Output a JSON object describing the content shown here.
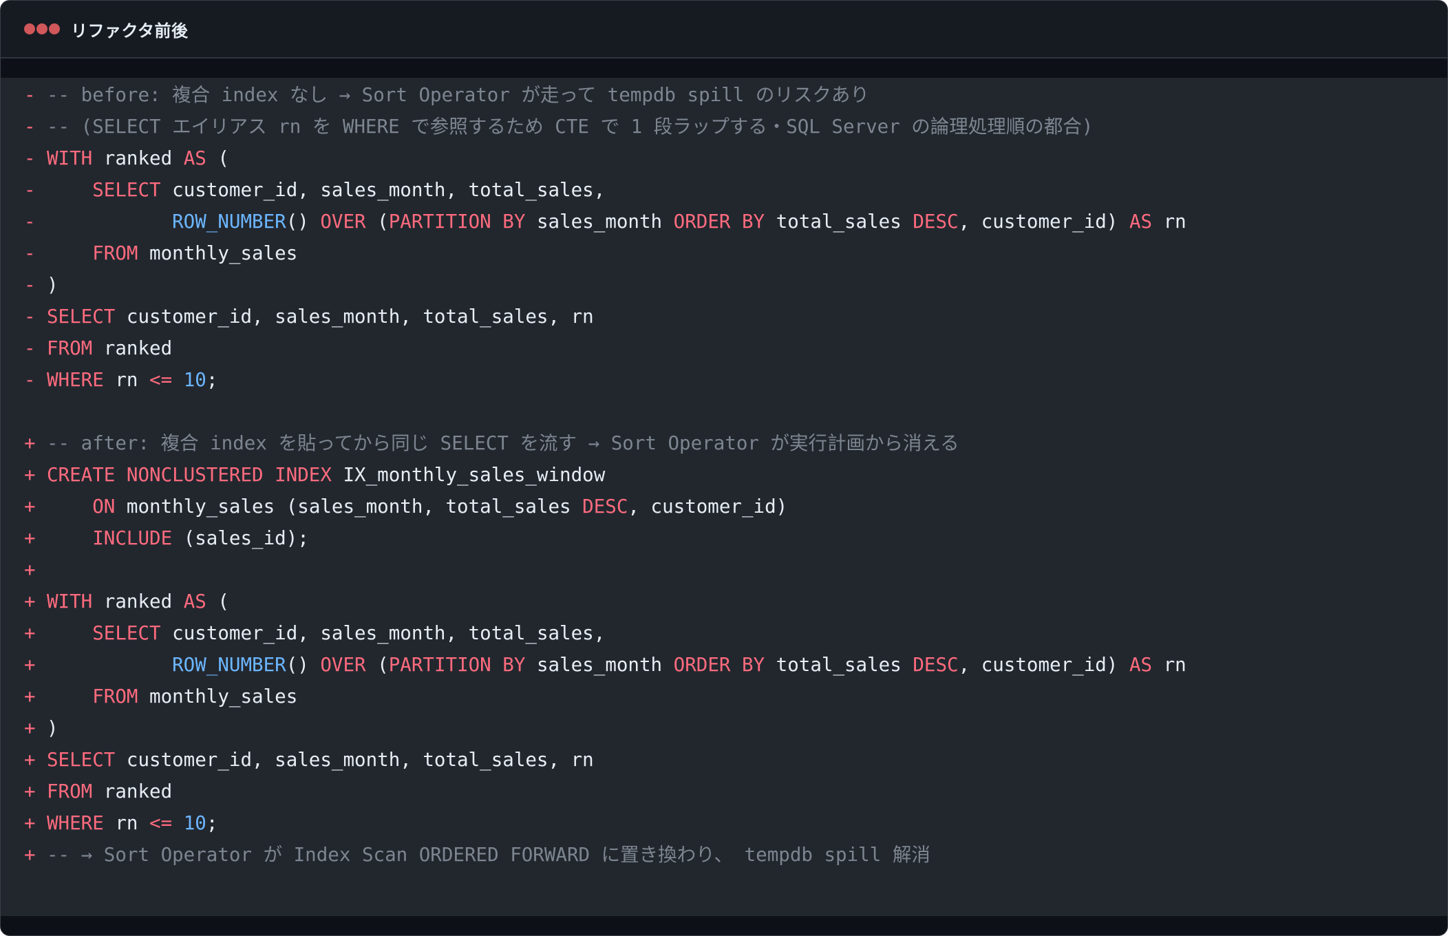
{
  "window": {
    "title": "リファクタ前後",
    "controls": [
      "close-dot",
      "minimize-dot",
      "maximize-dot"
    ]
  },
  "colors": {
    "background": "#22272e",
    "titlebar": "#161b22",
    "keyword": "#ff6b7e",
    "function": "#6cb6ff",
    "number": "#6cb6ff",
    "comment": "#7d8590",
    "text": "#e6edf3",
    "marker": "#ff6b7e"
  },
  "diff_lines": [
    {
      "marker": "-",
      "type": "del",
      "tokens": [
        {
          "t": "comment",
          "v": "-- before: 複合 index なし → Sort Operator が走って tempdb spill のリスクあり"
        }
      ]
    },
    {
      "marker": "-",
      "type": "del",
      "tokens": [
        {
          "t": "comment",
          "v": "-- (SELECT エイリアス rn を WHERE で参照するため CTE で 1 段ラップする・SQL Server の論理処理順の都合)"
        }
      ]
    },
    {
      "marker": "-",
      "type": "del",
      "tokens": [
        {
          "t": "kw",
          "v": "WITH"
        },
        {
          "t": "plain",
          "v": " ranked "
        },
        {
          "t": "kw",
          "v": "AS"
        },
        {
          "t": "plain",
          "v": " ("
        }
      ]
    },
    {
      "marker": "-",
      "type": "del",
      "tokens": [
        {
          "t": "plain",
          "v": "    "
        },
        {
          "t": "kw",
          "v": "SELECT"
        },
        {
          "t": "plain",
          "v": " customer_id, sales_month, total_sales,"
        }
      ]
    },
    {
      "marker": "-",
      "type": "del",
      "tokens": [
        {
          "t": "plain",
          "v": "           "
        },
        {
          "t": "fn",
          "v": "ROW_NUMBER"
        },
        {
          "t": "plain",
          "v": "() "
        },
        {
          "t": "kw",
          "v": "OVER"
        },
        {
          "t": "plain",
          "v": " ("
        },
        {
          "t": "kw",
          "v": "PARTITION BY"
        },
        {
          "t": "plain",
          "v": " sales_month "
        },
        {
          "t": "kw",
          "v": "ORDER BY"
        },
        {
          "t": "plain",
          "v": " total_sales "
        },
        {
          "t": "kw",
          "v": "DESC"
        },
        {
          "t": "plain",
          "v": ", customer_id) "
        },
        {
          "t": "kw",
          "v": "AS"
        },
        {
          "t": "plain",
          "v": " rn"
        }
      ]
    },
    {
      "marker": "-",
      "type": "del",
      "tokens": [
        {
          "t": "plain",
          "v": "    "
        },
        {
          "t": "kw",
          "v": "FROM"
        },
        {
          "t": "plain",
          "v": " monthly_sales"
        }
      ]
    },
    {
      "marker": "-",
      "type": "del",
      "tokens": [
        {
          "t": "plain",
          "v": ")"
        }
      ]
    },
    {
      "marker": "-",
      "type": "del",
      "tokens": [
        {
          "t": "kw",
          "v": "SELECT"
        },
        {
          "t": "plain",
          "v": " customer_id, sales_month, total_sales, rn"
        }
      ]
    },
    {
      "marker": "-",
      "type": "del",
      "tokens": [
        {
          "t": "kw",
          "v": "FROM"
        },
        {
          "t": "plain",
          "v": " ranked"
        }
      ]
    },
    {
      "marker": "-",
      "type": "del",
      "tokens": [
        {
          "t": "kw",
          "v": "WHERE"
        },
        {
          "t": "plain",
          "v": " rn "
        },
        {
          "t": "kw",
          "v": "<="
        },
        {
          "t": "plain",
          "v": " "
        },
        {
          "t": "num",
          "v": "10"
        },
        {
          "t": "plain",
          "v": ";"
        }
      ]
    },
    {
      "marker": "",
      "type": "blank",
      "tokens": []
    },
    {
      "marker": "+",
      "type": "add",
      "tokens": [
        {
          "t": "comment",
          "v": "-- after: 複合 index を貼ってから同じ SELECT を流す → Sort Operator が実行計画から消える"
        }
      ]
    },
    {
      "marker": "+",
      "type": "add",
      "tokens": [
        {
          "t": "kw",
          "v": "CREATE NONCLUSTERED INDEX"
        },
        {
          "t": "plain",
          "v": " IX_monthly_sales_window"
        }
      ]
    },
    {
      "marker": "+",
      "type": "add",
      "tokens": [
        {
          "t": "plain",
          "v": "    "
        },
        {
          "t": "kw",
          "v": "ON"
        },
        {
          "t": "plain",
          "v": " monthly_sales (sales_month, total_sales "
        },
        {
          "t": "kw",
          "v": "DESC"
        },
        {
          "t": "plain",
          "v": ", customer_id)"
        }
      ]
    },
    {
      "marker": "+",
      "type": "add",
      "tokens": [
        {
          "t": "plain",
          "v": "    "
        },
        {
          "t": "kw",
          "v": "INCLUDE"
        },
        {
          "t": "plain",
          "v": " (sales_id);"
        }
      ]
    },
    {
      "marker": "+",
      "type": "add",
      "tokens": []
    },
    {
      "marker": "+",
      "type": "add",
      "tokens": [
        {
          "t": "kw",
          "v": "WITH"
        },
        {
          "t": "plain",
          "v": " ranked "
        },
        {
          "t": "kw",
          "v": "AS"
        },
        {
          "t": "plain",
          "v": " ("
        }
      ]
    },
    {
      "marker": "+",
      "type": "add",
      "tokens": [
        {
          "t": "plain",
          "v": "    "
        },
        {
          "t": "kw",
          "v": "SELECT"
        },
        {
          "t": "plain",
          "v": " customer_id, sales_month, total_sales,"
        }
      ]
    },
    {
      "marker": "+",
      "type": "add",
      "tokens": [
        {
          "t": "plain",
          "v": "           "
        },
        {
          "t": "fn",
          "v": "ROW_NUMBER"
        },
        {
          "t": "plain",
          "v": "() "
        },
        {
          "t": "kw",
          "v": "OVER"
        },
        {
          "t": "plain",
          "v": " ("
        },
        {
          "t": "kw",
          "v": "PARTITION BY"
        },
        {
          "t": "plain",
          "v": " sales_month "
        },
        {
          "t": "kw",
          "v": "ORDER BY"
        },
        {
          "t": "plain",
          "v": " total_sales "
        },
        {
          "t": "kw",
          "v": "DESC"
        },
        {
          "t": "plain",
          "v": ", customer_id) "
        },
        {
          "t": "kw",
          "v": "AS"
        },
        {
          "t": "plain",
          "v": " rn"
        }
      ]
    },
    {
      "marker": "+",
      "type": "add",
      "tokens": [
        {
          "t": "plain",
          "v": "    "
        },
        {
          "t": "kw",
          "v": "FROM"
        },
        {
          "t": "plain",
          "v": " monthly_sales"
        }
      ]
    },
    {
      "marker": "+",
      "type": "add",
      "tokens": [
        {
          "t": "plain",
          "v": ")"
        }
      ]
    },
    {
      "marker": "+",
      "type": "add",
      "tokens": [
        {
          "t": "kw",
          "v": "SELECT"
        },
        {
          "t": "plain",
          "v": " customer_id, sales_month, total_sales, rn"
        }
      ]
    },
    {
      "marker": "+",
      "type": "add",
      "tokens": [
        {
          "t": "kw",
          "v": "FROM"
        },
        {
          "t": "plain",
          "v": " ranked"
        }
      ]
    },
    {
      "marker": "+",
      "type": "add",
      "tokens": [
        {
          "t": "kw",
          "v": "WHERE"
        },
        {
          "t": "plain",
          "v": " rn "
        },
        {
          "t": "kw",
          "v": "<="
        },
        {
          "t": "plain",
          "v": " "
        },
        {
          "t": "num",
          "v": "10"
        },
        {
          "t": "plain",
          "v": ";"
        }
      ]
    },
    {
      "marker": "+",
      "type": "add",
      "tokens": [
        {
          "t": "comment",
          "v": "-- → Sort Operator が Index Scan ORDERED FORWARD に置き換わり、 tempdb spill 解消"
        }
      ]
    }
  ]
}
